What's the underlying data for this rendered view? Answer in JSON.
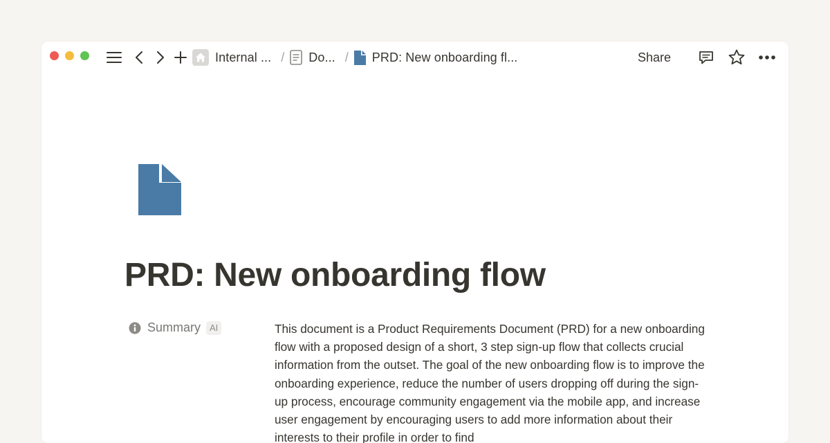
{
  "window": {
    "controls": [
      "close",
      "minimize",
      "zoom"
    ],
    "colors": {
      "close": "#ee5b54",
      "minimize": "#f4bd3d",
      "zoom": "#5fc453"
    }
  },
  "toolbar": {
    "icons": [
      "menu-icon",
      "back-icon",
      "forward-icon",
      "plus-icon"
    ]
  },
  "breadcrumb": [
    {
      "icon": "home-icon",
      "label": "Internal ..."
    },
    {
      "icon": "page-icon",
      "label": "Do..."
    },
    {
      "icon": "document-icon",
      "label": "PRD: New onboarding fl..."
    }
  ],
  "actions": {
    "share_label": "Share",
    "icons": [
      "comment-icon",
      "star-icon",
      "more-icon"
    ]
  },
  "page": {
    "icon": "document-icon",
    "icon_color": "#4a7ba6",
    "title": "PRD: New onboarding flow",
    "property": {
      "icon": "info-icon",
      "name": "Summary",
      "badge": "AI",
      "value": "This document is a Product Requirements Document (PRD) for a new onboarding flow with a proposed design of a short, 3 step sign-up flow that collects crucial information from the outset. The goal of the new onboarding flow is to improve the onboarding experience, reduce the number of users dropping off during the sign-up process, encourage community engagement via the mobile app, and increase user engagement by encouraging users to add more information about their interests to their profile in order to find"
    }
  }
}
